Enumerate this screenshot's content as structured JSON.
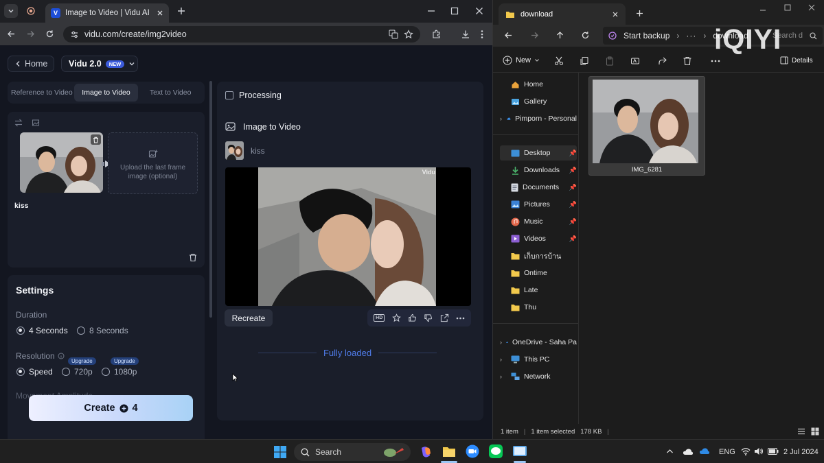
{
  "browser": {
    "tab_title": "Image to Video | Vidu AI",
    "favicon_letter": "V",
    "url": "vidu.com/create/img2video"
  },
  "vidu": {
    "home_label": "Home",
    "model_label": "Vidu 2.0",
    "new_badge": "NEW",
    "tabs": [
      {
        "label": "Reference to Video"
      },
      {
        "label": "Image to Video"
      },
      {
        "label": "Text to Video"
      }
    ],
    "upload_last_frame": "Upload the last frame image (optional)",
    "prompt_text": "kiss",
    "settings": {
      "title": "Settings",
      "duration_label": "Duration",
      "duration_options": [
        "4 Seconds",
        "8 Seconds"
      ],
      "duration_selected": "4 Seconds",
      "resolution_label": "Resolution",
      "resolution_options": [
        "Speed",
        "720p",
        "1080p"
      ],
      "resolution_selected": "Speed",
      "upgrade_label": "Upgrade",
      "movement_label": "Movement Amplitude"
    },
    "create_label": "Create",
    "create_cost": "4",
    "result": {
      "processing_label": "Processing",
      "section_title": "Image to Video",
      "prompt": "kiss",
      "watermark": "Vidu",
      "recreate_label": "Recreate",
      "hd_label": "HD",
      "fully_loaded": "Fully loaded"
    }
  },
  "explorer": {
    "tab_title": "download",
    "start_backup": "Start backup",
    "crumb_folder": "download",
    "search_placeholder": "Search d",
    "new_label": "New",
    "details_label": "Details",
    "nav": [
      {
        "label": "Home"
      },
      {
        "label": "Gallery"
      },
      {
        "label": "Pimporn - Personal"
      },
      {
        "label": "Desktop"
      },
      {
        "label": "Downloads"
      },
      {
        "label": "Documents"
      },
      {
        "label": "Pictures"
      },
      {
        "label": "Music"
      },
      {
        "label": "Videos"
      },
      {
        "label": "เก็บการบ้าน"
      },
      {
        "label": "Ontime"
      },
      {
        "label": "Late"
      },
      {
        "label": "Thu"
      },
      {
        "label": "OneDrive - Saha Pa"
      },
      {
        "label": "This PC"
      },
      {
        "label": "Network"
      }
    ],
    "file_name": "IMG_6281",
    "status": {
      "count": "1 item",
      "selected": "1 item selected",
      "size": "178 KB"
    }
  },
  "watermark": "iQIYI",
  "taskbar": {
    "search_label": "Search",
    "lang": "ENG",
    "date": "2 Jul 2024"
  },
  "colors": {
    "accent_blue": "#4f7be8",
    "create_gradient_end": "#a8d2f6",
    "new_badge": "#3b5bdb"
  }
}
